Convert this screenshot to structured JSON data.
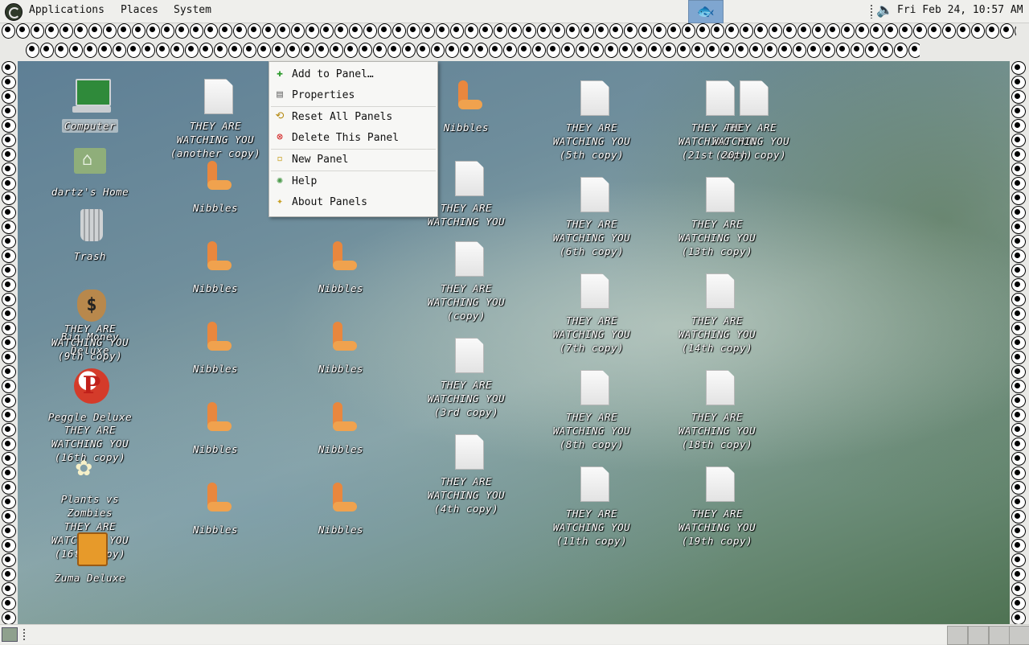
{
  "top_panel": {
    "menus": [
      "Applications",
      "Places",
      "System"
    ],
    "clock": "Fri Feb 24, 10:57 AM",
    "icons": {
      "distro": "distro-logo-icon",
      "launcher": "fish-icon",
      "volume": "speaker-icon"
    }
  },
  "context_menu": {
    "items": [
      {
        "label": "Add to Panel…",
        "icon": "plus-icon",
        "color": "#2e9b2e"
      },
      {
        "label": "Properties",
        "icon": "properties-icon",
        "color": "#777777"
      },
      {
        "label": "Reset All Panels",
        "icon": "reset-icon",
        "color": "#b58a12"
      },
      {
        "label": "Delete This Panel",
        "icon": "delete-icon",
        "color": "#d22020"
      },
      {
        "label": "New Panel",
        "icon": "new-panel-icon",
        "color": "#c9a227"
      },
      {
        "label": "Help",
        "icon": "help-icon",
        "color": "#4a9a4a"
      },
      {
        "label": "About Panels",
        "icon": "star-icon",
        "color": "#c9a227"
      }
    ]
  },
  "desktop_icons": {
    "computer": "Computer",
    "home": "dartz's Home",
    "trash": "Trash",
    "big_money": "Big Money Deluxe",
    "peggle": "Peggle Deluxe",
    "plants": "Plants vs Zombies",
    "zuma": "Zuma Deluxe",
    "nibbles": "Nibbles",
    "docs": {
      "another_copy": "THEY ARE WATCHING YOU (another copy)",
      "original": "THEY ARE WATCHING YOU",
      "copy": "THEY ARE WATCHING YOU (copy)",
      "c3": "THEY ARE WATCHING YOU (3rd copy)",
      "c4": "THEY ARE WATCHING YOU (4th copy)",
      "c5": "THEY ARE WATCHING YOU (5th copy)",
      "c6": "THEY ARE WATCHING YOU (6th copy)",
      "c7": "THEY ARE WATCHING YOU (7th copy)",
      "c8": "THEY ARE WATCHING YOU (8th copy)",
      "c9": "THEY ARE WATCHING YOU (9th copy)",
      "c11": "THEY ARE WATCHING YOU (11th copy)",
      "c13": "THEY ARE WATCHING YOU (13th copy)",
      "c14": "THEY ARE WATCHING YOU (14th copy)",
      "c16": "THEY ARE WATCHING YOU (16th copy)",
      "c18": "THEY ARE WATCHING YOU (18th copy)",
      "c19": "THEY ARE WATCHING YOU (19th copy)",
      "c21": "THEY ARE WATCHING YOU (21st copy)",
      "c20": "THEY ARE WATCHING YOU (20th copy)"
    }
  }
}
